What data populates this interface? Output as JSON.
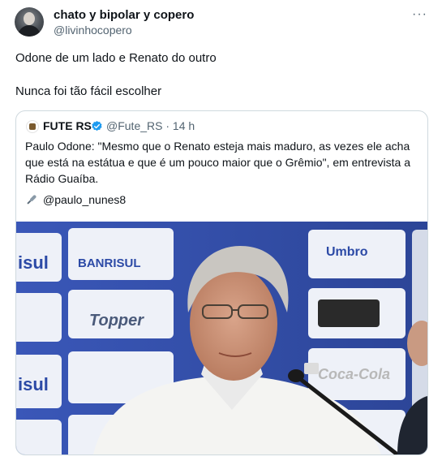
{
  "author": {
    "display_name": "chato y bipolar y copero",
    "handle": "@livinhocopero",
    "more_label": "···"
  },
  "tweet_text": {
    "line1": "Odone de um lado e Renato do outro",
    "line2": "Nunca foi tão fácil escolher"
  },
  "quoted": {
    "name": "FUTE RS",
    "handle_time": "@Fute_RS · 14 h",
    "text_lines": [
      "Paulo Odone: \"Mesmo que o Renato esteja mais maduro, as vezes ele acha",
      "que está na estátua e que é um pouco maior que o Grêmio\", em entrevista a",
      "Rádio Guaíba."
    ],
    "mention": "@paulo_nunes8",
    "photo": {
      "backdrop_words": [
        "isul",
        "BANRISUL",
        "Topper",
        "Umbro",
        "Coca-Cola",
        "isul"
      ],
      "icon": "press-conference-photo"
    }
  },
  "colors": {
    "text_primary": "#0f1419",
    "text_secondary": "#536471",
    "border": "#cfd9de",
    "verified_blue": "#1d9bf0"
  }
}
